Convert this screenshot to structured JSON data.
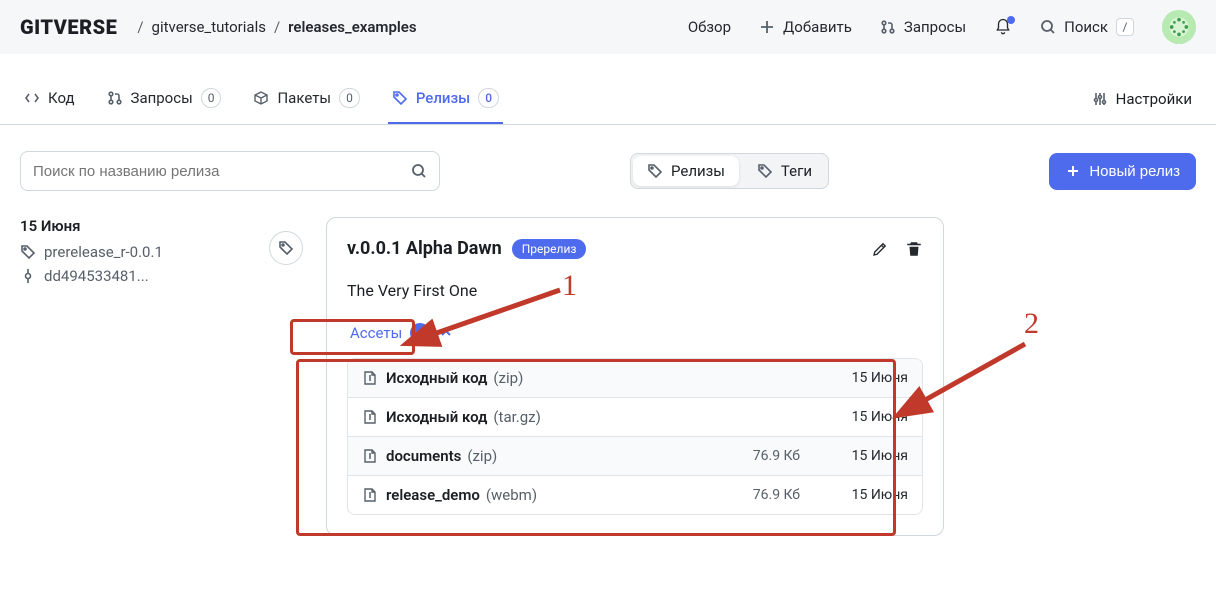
{
  "brand": "GITVERSE",
  "breadcrumbs": {
    "owner": "gitverse_tutorials",
    "repo": "releases_examples"
  },
  "topnav": {
    "overview": "Обзор",
    "add": "Добавить",
    "requests": "Запросы",
    "search": "Поиск",
    "search_kbd": "/"
  },
  "tabs": {
    "code": "Код",
    "requests": "Запросы",
    "requests_count": "0",
    "packages": "Пакеты",
    "packages_count": "0",
    "releases": "Релизы",
    "releases_count": "0",
    "settings": "Настройки"
  },
  "toolbar": {
    "search_placeholder": "Поиск по названию релиза",
    "segment_releases": "Релизы",
    "segment_tags": "Теги",
    "new_release": "Новый релиз"
  },
  "sidebar": {
    "date": "15 Июня",
    "tag": "prerelease_r-0.0.1",
    "commit": "dd494533481..."
  },
  "release": {
    "title": "v.0.0.1 Alpha Dawn",
    "badge": "Пререлиз",
    "description": "The Very First One",
    "assets_label": "Ассеты",
    "assets_count": "4",
    "assets": [
      {
        "name": "Исходный код",
        "ext": "(zip)",
        "size": "",
        "date": "15 Июня"
      },
      {
        "name": "Исходный код",
        "ext": "(tar.gz)",
        "size": "",
        "date": "15 Июня"
      },
      {
        "name": "documents",
        "ext": "(zip)",
        "size": "76.9 Кб",
        "date": "15 Июня"
      },
      {
        "name": "release_demo",
        "ext": "(webm)",
        "size": "76.9 Кб",
        "date": "15 Июня"
      }
    ]
  },
  "annotations": {
    "label1": "1",
    "label2": "2"
  }
}
